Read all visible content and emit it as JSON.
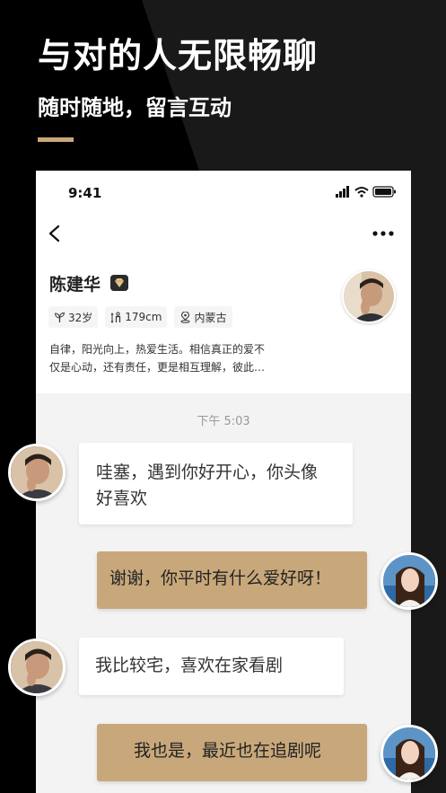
{
  "promo": {
    "headline": "与对的人无限畅聊",
    "subline": "随时随地，留言互动",
    "accent_color": "#c9a77c"
  },
  "status_bar": {
    "time": "9:41",
    "icons": [
      "signal-icon",
      "wifi-icon",
      "battery-icon"
    ]
  },
  "header": {
    "back_icon": "chevron-left-icon",
    "more_icon": "more-dots-icon"
  },
  "profile": {
    "name": "陈建华",
    "badge_icon": "diamond-icon",
    "tags": [
      {
        "icon": "sprout-icon",
        "label": "32岁"
      },
      {
        "icon": "height-icon",
        "label": "179cm"
      },
      {
        "icon": "location-icon",
        "label": "内蒙古"
      }
    ],
    "bio_line1": "自律，阳光向上，热爱生活。相信真正的爱不",
    "bio_line2": "仅是心动，还有责任，更是相互理解，彼此…"
  },
  "chat": {
    "timestamp": "下午 5:03",
    "messages": [
      {
        "side": "left",
        "line1": "哇塞，遇到你好开心，你头像",
        "line2": "好喜欢"
      },
      {
        "side": "right",
        "line1": "谢谢，你平时有什么爱好呀！"
      },
      {
        "side": "left",
        "line1": "我比较宅，喜欢在家看剧"
      },
      {
        "side": "right",
        "line1": "我也是，最近也在追剧呢"
      }
    ],
    "bubble_color_right": "#c8a87a",
    "bubble_color_left": "#ffffff"
  }
}
